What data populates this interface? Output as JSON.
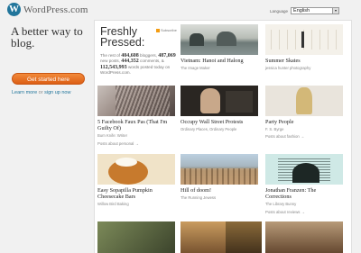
{
  "header": {
    "logo_mark": "W",
    "logo_text": "WordPress.com",
    "language_label": "Language",
    "language_value": "English"
  },
  "left": {
    "tagline": "A better way to blog.",
    "cta_label": "Get started here",
    "learn_more": "Learn more",
    "or_text": "or",
    "sign_up": "sign up now"
  },
  "freshly_pressed": {
    "title": "Freshly Pressed:",
    "subscribe": "Subscribe",
    "stats": {
      "bloggers_count": "404,608",
      "bloggers_text": "bloggers,",
      "posts_count": "487,069",
      "posts_text": "new posts,",
      "comments_count": "444,352",
      "comments_text": "comments, &",
      "words_count": "112,543,993",
      "words_text": "words posted today on WordPress.com."
    }
  },
  "posts": [
    {
      "title": "Vietnam: Hanoi and Halong",
      "author": "The Image Maker",
      "icon": "photo-thumbnail"
    },
    {
      "title": "Summer Skates",
      "author": "jessica hunter photography",
      "icon": "photo-thumbnail"
    },
    {
      "title": "5 Facebook Faux Pas (That I'm Guilty Of)",
      "author": "Burn Knife: Writer",
      "icon": "photo-thumbnail"
    },
    {
      "title": "Occupy Wall Street Protests",
      "author": "Ordinary Places, Ordinary People",
      "icon": "photo-thumbnail"
    },
    {
      "title": "Party People",
      "author": "F. S. Byrge",
      "icon": "photo-thumbnail"
    },
    {
      "title": "Easy Sopapilla Pumpkin Cheesecake Bars",
      "author": "Willow Bird Baking",
      "icon": "photo-thumbnail"
    },
    {
      "title": "Hill of doom!",
      "author": "The Running Jewess",
      "icon": "photo-thumbnail"
    },
    {
      "title": "Jonathan Franzen: The Corrections",
      "author": "The Library Bunny",
      "icon": "photo-thumbnail"
    }
  ],
  "category_links": {
    "personal": "Posts about personal →",
    "fashion": "Posts about fashion →",
    "reviews": "Posts about reviews →"
  },
  "colors": {
    "brand_blue": "#21759b",
    "cta_orange": "#e06a1f",
    "background": "#f1f1f1"
  }
}
